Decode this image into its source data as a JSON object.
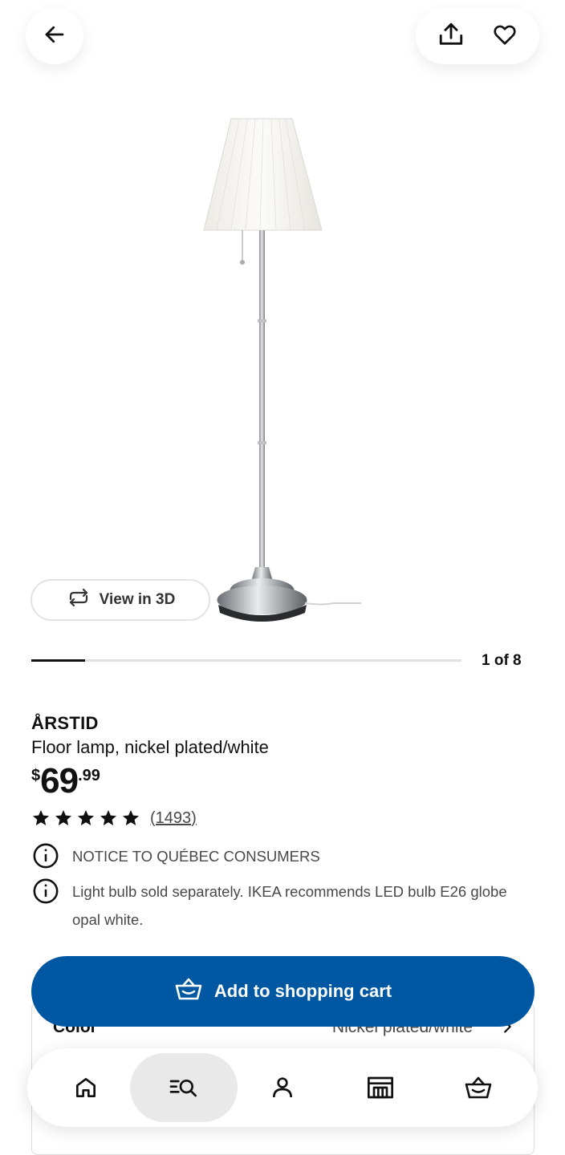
{
  "header": {
    "back_icon": "arrow-left-icon",
    "share_icon": "share-icon",
    "favorite_icon": "heart-icon"
  },
  "gallery": {
    "view3d_label": "View in 3D",
    "counter": "1 of 8",
    "current_fraction": 0.125
  },
  "product": {
    "name": "ÅRSTID",
    "description": "Floor lamp, nickel plated/white",
    "price_currency": "$",
    "price_integer": "69",
    "price_decimal": ".99",
    "rating_stars": 5,
    "rating_count": "(1493)"
  },
  "notices": [
    "NOTICE TO QUÉBEC CONSUMERS",
    "Light bulb sold separately. IKEA recommends LED bulb E26 globe opal white."
  ],
  "color_option": {
    "label": "Color",
    "value": "Nickel plated/white"
  },
  "cart_button": {
    "label": "Add to shopping cart"
  },
  "nav": {
    "items": [
      "home-icon",
      "search-icon",
      "profile-icon",
      "store-icon",
      "cart-icon"
    ],
    "active": "search-icon"
  },
  "colors": {
    "brand_blue": "#0058a3",
    "text_primary": "#111111",
    "text_secondary": "#484848"
  }
}
